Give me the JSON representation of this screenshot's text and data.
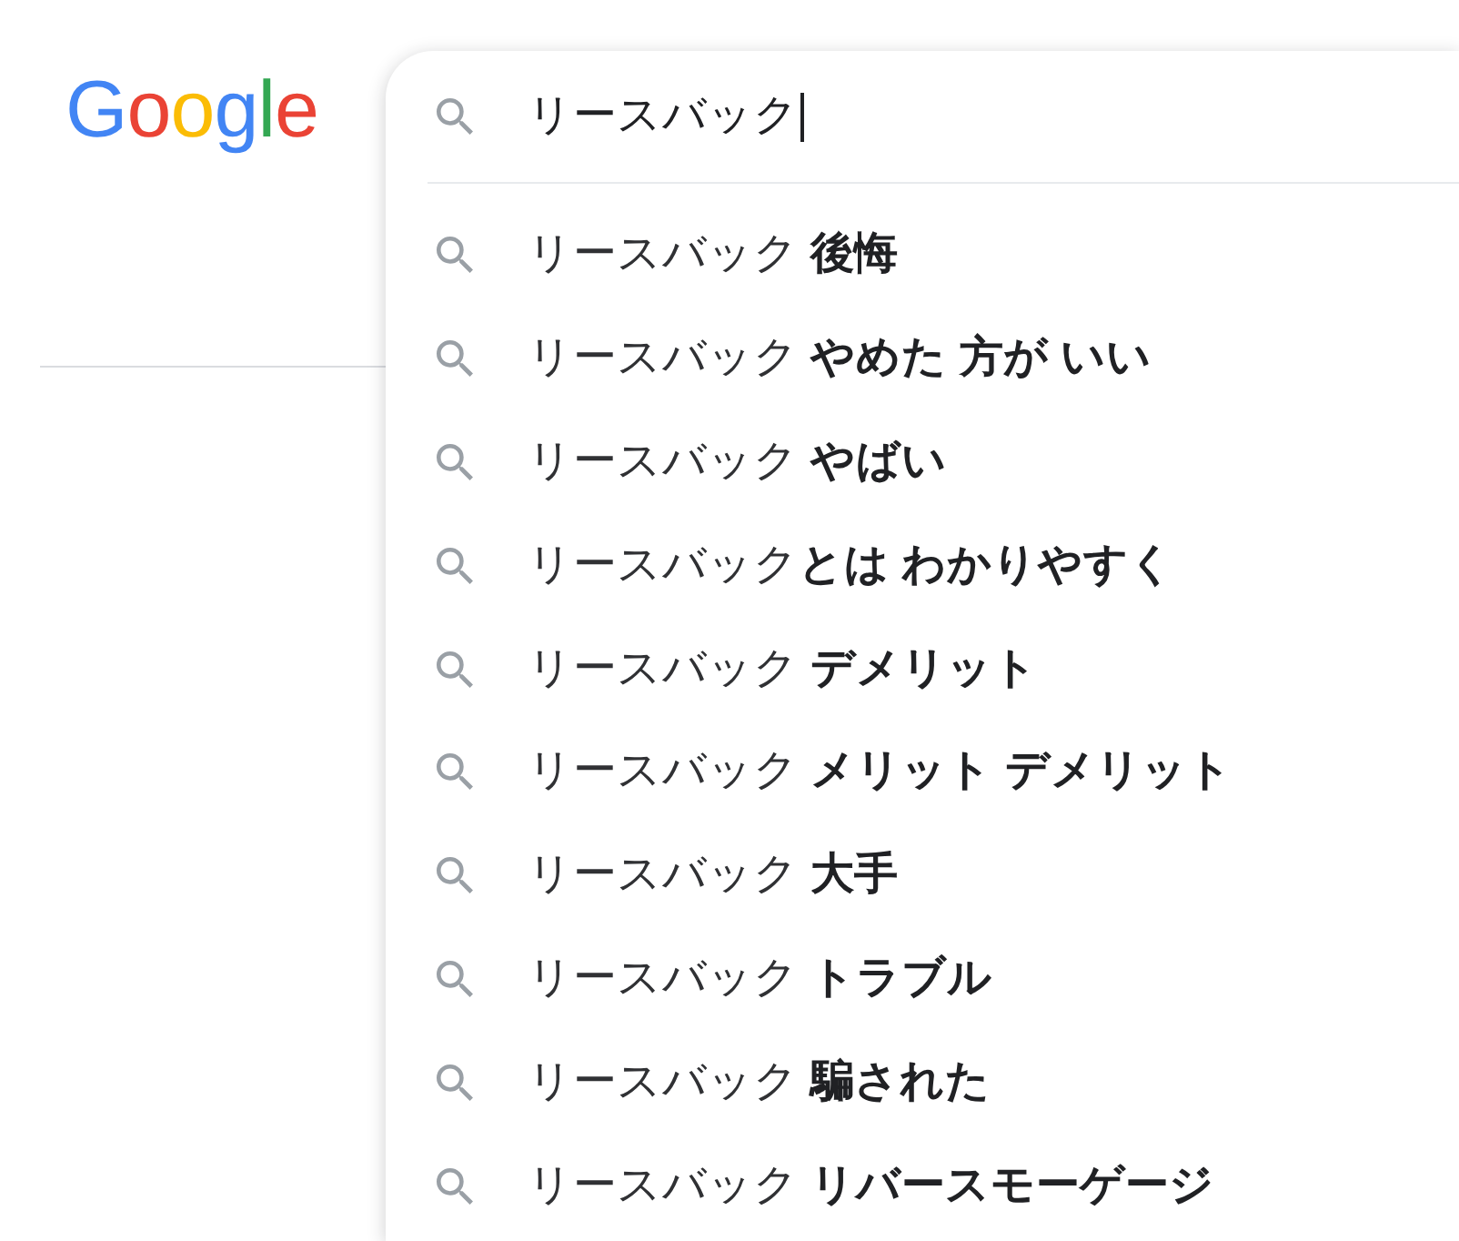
{
  "logo": {
    "text": "Google"
  },
  "search": {
    "value": "リースバック",
    "focused": true
  },
  "suggestions": [
    "リースバック **後悔**",
    "リースバック **やめた 方が いい**",
    "リースバック **やばい**",
    "リースバック**とは わかりやすく**",
    "リースバック **デメリット**",
    "リースバック **メリット デメリット**",
    "リースバック **大手**",
    "リースバック **トラブル**",
    "リースバック **騙された**",
    "リースバック **リバースモーゲージ**"
  ]
}
